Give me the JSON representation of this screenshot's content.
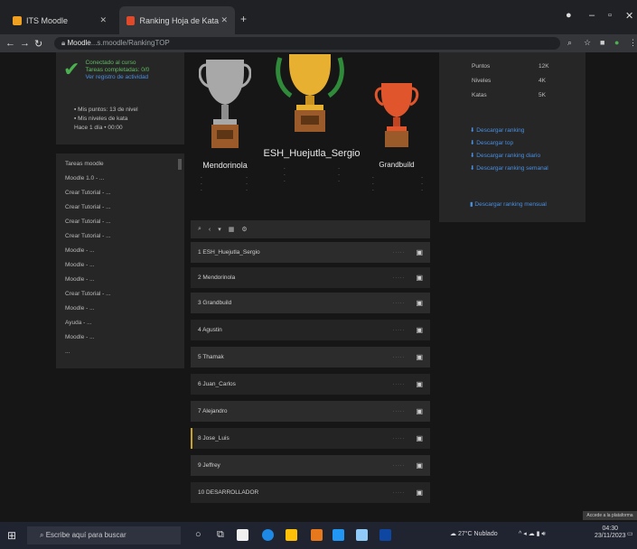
{
  "browser": {
    "tabs": [
      {
        "title": "ITS Moodle",
        "active": false
      },
      {
        "title": "Ranking Hoja de Kata Moodle",
        "active": true
      }
    ],
    "url_host": "Moodle",
    "url_path": "...s.moodle/RankingTOP"
  },
  "sidebar": {
    "status_title": "Conectado al curso",
    "status_line2": "Tareas completadas: 0/0",
    "status_link": "Ver registro de actividad",
    "info_lines": [
      "Mis puntos: 13 de nivel",
      "Mis niveles de kata",
      "Hace 1 día • 00:00"
    ],
    "list_header": "Tareas moodle",
    "list_items": [
      "Moodle 1.0 - ...",
      "Crear Tutorial - ...",
      "Crear Tutorial - ...",
      "Crear Tutorial - ...",
      "Crear Tutorial - ...",
      "Moodle - ...",
      "Moodle - ...",
      "Moodle - ...",
      "Crear Tutorial - ...",
      "Moodle - ...",
      "Ayuda - ...",
      "Moodle - ...",
      "..."
    ]
  },
  "podium": {
    "first": {
      "name": "ESH_Huejutla_Sergio"
    },
    "second": {
      "name": "Mendorinola"
    },
    "third": {
      "name": "Grandbuild"
    }
  },
  "ranking": {
    "rows": [
      {
        "name": "ESH_Huejutla_Sergio"
      },
      {
        "name": "Mendorinola"
      },
      {
        "name": "Grandbuild"
      },
      {
        "name": "Agustin"
      },
      {
        "name": "Thamak"
      },
      {
        "name": "Juan_Carlos"
      },
      {
        "name": "Alejandro"
      },
      {
        "name": "Jose_Luis"
      },
      {
        "name": "Jeffrey"
      },
      {
        "name": "DESARROLLADOR"
      }
    ]
  },
  "right_panel": {
    "stats": [
      {
        "label": "Puntos",
        "value": "12K"
      },
      {
        "label": "Niveles",
        "value": "4K"
      },
      {
        "label": "Katas",
        "value": "5K"
      }
    ],
    "links": [
      "Descargar ranking",
      "Descargar top",
      "Descargar ranking diario",
      "Descargar ranking semanal",
      "Descargar ranking mensual"
    ]
  },
  "taskbar": {
    "search_placeholder": "Escribe aquí para buscar",
    "weather": "27°C Nublado",
    "time": "04:30",
    "date": "23/11/2023",
    "tooltip": "Accede a la plataforma"
  },
  "colors": {
    "accent_gold": "#e8b030",
    "accent_silver": "#a8a8a8",
    "accent_bronze": "#e0552b",
    "link": "#4a8fe0",
    "success": "#5ebd62"
  }
}
